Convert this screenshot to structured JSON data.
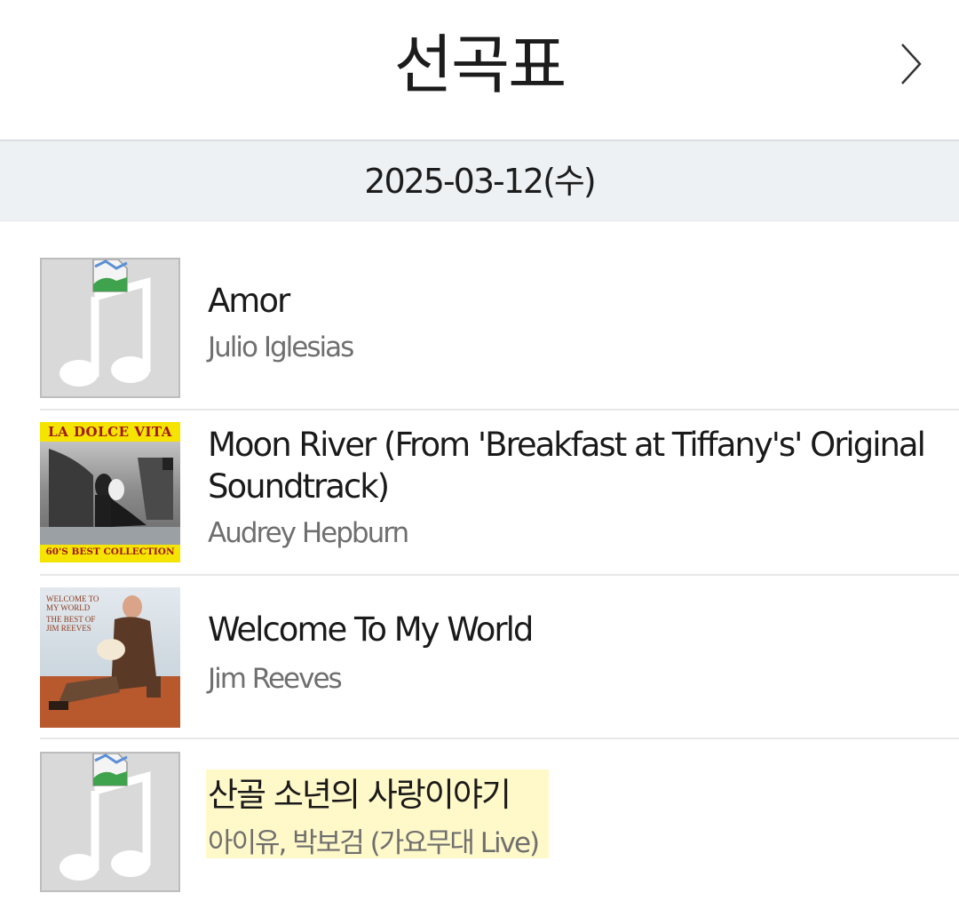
{
  "header": {
    "title": "선곡표"
  },
  "date_bar": {
    "date": "2025-03-12(수)"
  },
  "songs": [
    {
      "title": "Amor",
      "artist": "Julio Iglesias",
      "art": "placeholder"
    },
    {
      "title": "Moon River (From 'Breakfast at Tiffany's' Original",
      "title_line2": "Soundtrack)",
      "artist": "Audrey Hepburn",
      "art": "album-cover",
      "cover_top": "LA DOLCE VITA",
      "cover_bottom": "60'S BEST COLLECTION"
    },
    {
      "title": "Welcome To My World",
      "artist": "Jim Reeves",
      "art": "album-cover",
      "cover_text": [
        "WELCOME TO",
        "MY WORLD",
        "THE BEST OF",
        "JIM REEVES"
      ]
    },
    {
      "title": "산골 소년의 사랑이야기",
      "artist": "아이유, 박보검 (가요무대 Live)",
      "art": "placeholder",
      "highlighted": true
    }
  ],
  "colors": {
    "highlight": "#fff8c8",
    "date_bar_bg": "#eef1f4",
    "placeholder_bg": "#d9d9d9",
    "cover_yellow": "#f5e400"
  },
  "icons": {
    "next": "chevron-right-icon",
    "placeholder": "music-note-icon",
    "broken_image": "broken-image-icon"
  }
}
